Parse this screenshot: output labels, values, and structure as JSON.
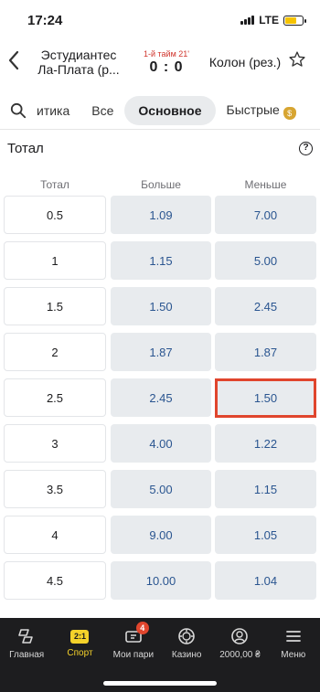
{
  "status_bar": {
    "time": "17:24",
    "network": "LTE"
  },
  "match": {
    "team1": "Эстудиантес Ла-Плата (р...",
    "period": "1-й тайм 21'",
    "score": "0 : 0",
    "team2": "Колон (рез.)"
  },
  "tabs": [
    "итика",
    "Все",
    "Основное",
    "Быстрые"
  ],
  "active_tab": "Основное",
  "section": {
    "title": "Тотал"
  },
  "columns": {
    "total": "Тотал",
    "over": "Больше",
    "under": "Меньше"
  },
  "rows": [
    {
      "total": "0.5",
      "over": "1.09",
      "under": "7.00"
    },
    {
      "total": "1",
      "over": "1.15",
      "under": "5.00"
    },
    {
      "total": "1.5",
      "over": "1.50",
      "under": "2.45"
    },
    {
      "total": "2",
      "over": "1.87",
      "under": "1.87"
    },
    {
      "total": "2.5",
      "over": "2.45",
      "under": "1.50"
    },
    {
      "total": "3",
      "over": "4.00",
      "under": "1.22"
    },
    {
      "total": "3.5",
      "over": "5.00",
      "under": "1.15"
    },
    {
      "total": "4",
      "over": "9.00",
      "under": "1.05"
    },
    {
      "total": "4.5",
      "over": "10.00",
      "under": "1.04"
    }
  ],
  "highlighted": {
    "row": "2.5",
    "column": "under"
  },
  "bottom_nav": {
    "items": [
      {
        "label": "Главная",
        "icon": "home-icon"
      },
      {
        "label": "Спорт",
        "icon": "sport-icon",
        "icon_text": "2:1",
        "active": true
      },
      {
        "label": "Мои пари",
        "icon": "ticket-icon",
        "badge": "4"
      },
      {
        "label": "Казино",
        "icon": "casino-chip-icon"
      },
      {
        "label": "2000,00 ₴",
        "icon": "profile-icon"
      },
      {
        "label": "Меню",
        "icon": "menu-icon"
      }
    ]
  },
  "colors": {
    "accent": "#f5d22a",
    "odds_text": "#2a5590",
    "highlight": "#e0452d",
    "nav_bg": "#1d1d1f"
  }
}
